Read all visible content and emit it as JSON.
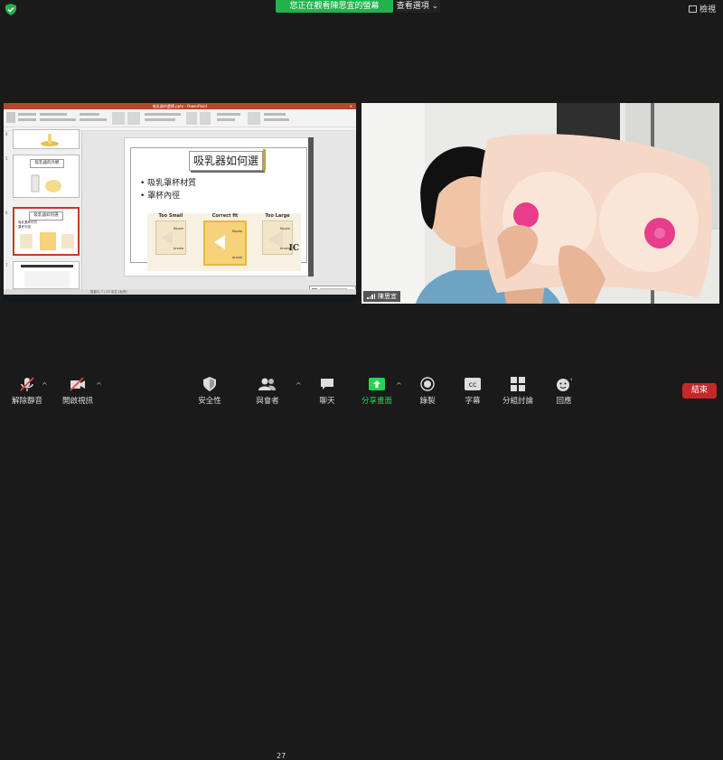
{
  "top": {
    "share_banner": "您正在觀看陳思宜的螢幕",
    "view_options": "查看選項",
    "view_button": "檢視"
  },
  "ppt": {
    "window_title": "吸乳器的選擇.pptx - PowerPoint",
    "status_text": "投影片 7 / 43  中文 (台灣)",
    "slide": {
      "title": "吸乳器如何選",
      "bullets": [
        "吸乳罩杯材質",
        "罩杯內徑"
      ],
      "fit_labels": [
        "Too Small",
        "Correct fit",
        "Too Large"
      ],
      "part_labels": [
        "Nipple",
        "Areola"
      ],
      "logo": "IC"
    },
    "thumbs": [
      {
        "num": "4",
        "title": ""
      },
      {
        "num": "5",
        "title": "吸乳器的外觀"
      },
      {
        "num": "6",
        "title": "吸乳器如何選"
      },
      {
        "num": "7",
        "title": ""
      }
    ],
    "thumb6_bullets": [
      "吸乳罩杯材質",
      "罩杯內徑"
    ]
  },
  "video": {
    "participant_name": "陳思宜"
  },
  "toolbar": {
    "unmute": "解除靜音",
    "start_video": "開啟視訊",
    "security": "安全性",
    "participants": "與會者",
    "participants_count": "27",
    "chat": "聊天",
    "share_screen": "分享畫面",
    "record": "錄製",
    "captions": "字幕",
    "breakout": "分組討論",
    "reactions": "回應",
    "end": "結束"
  },
  "colors": {
    "green": "#22b24c",
    "end_red": "#c62828",
    "ppt_red": "#b7472a"
  }
}
